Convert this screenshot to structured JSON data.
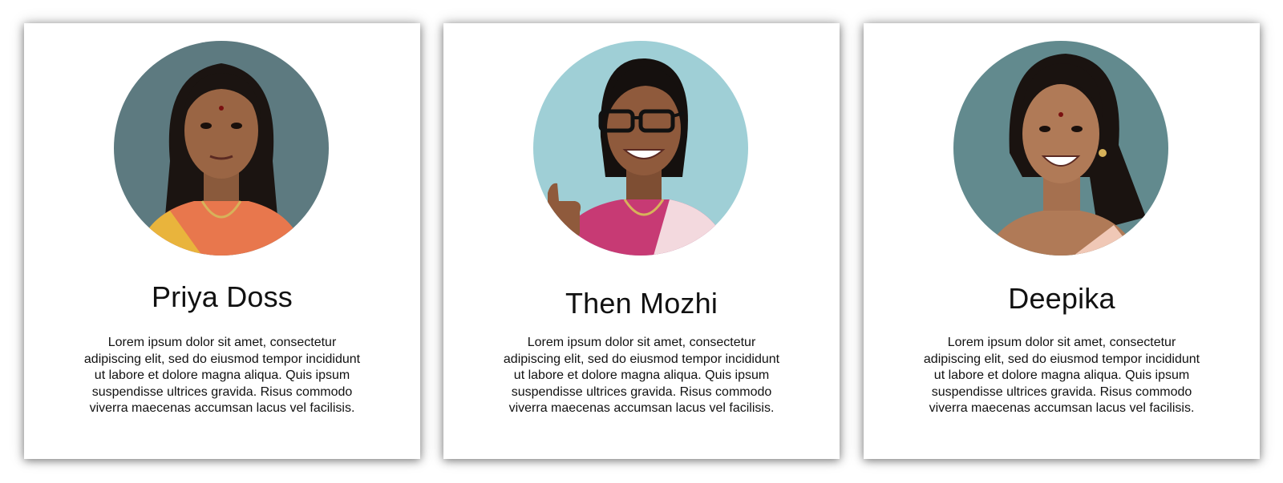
{
  "profiles": [
    {
      "name": "Priya Doss",
      "bio": "Lorem ipsum dolor sit amet, consectetur adipiscing elit, sed do eiusmod tempor incididunt ut labore et dolore magna aliqua. Quis ipsum suspendisse ultrices gravida. Risus commodo viverra maecenas accumsan lacus vel facilisis.",
      "photo_background": "#5d7a80",
      "saree_color": "#e8774d"
    },
    {
      "name": "Then Mozhi",
      "bio": "Lorem ipsum dolor sit amet, consectetur adipiscing elit, sed do eiusmod tempor incididunt ut labore et dolore magna aliqua. Quis ipsum suspendisse ultrices gravida. Risus commodo viverra maecenas accumsan lacus vel facilisis.",
      "photo_background": "#9fcfd6",
      "saree_color": "#c73a74"
    },
    {
      "name": "Deepika",
      "bio": "Lorem ipsum dolor sit amet, consectetur adipiscing elit, sed do eiusmod tempor incididunt ut labore et dolore magna aliqua. Quis ipsum suspendisse ultrices gravida. Risus commodo viverra maecenas accumsan lacus vel facilisis.",
      "photo_background": "#628a8e",
      "saree_color": "#f0c8b6"
    }
  ]
}
